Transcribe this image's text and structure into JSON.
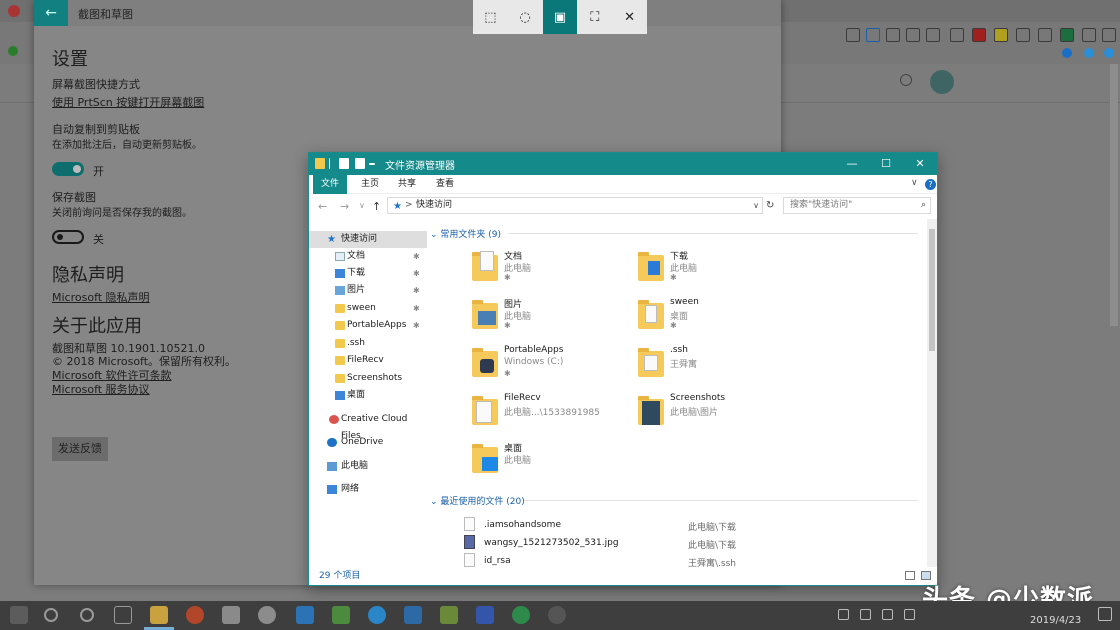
{
  "background": {
    "watermark": "头条 @少数派",
    "date": "2019/4/23"
  },
  "snip_window": {
    "title": "截图和草图",
    "back_glyph": "←",
    "settings_heading": "设置",
    "shortcut_label": "屏幕截图快捷方式",
    "shortcut_link": "使用 PrtScn 按键打开屏幕截图",
    "auto_copy_label": "自动复制到剪贴板",
    "auto_copy_desc": "在添加批注后，自动更新剪贴板。",
    "toggle_on_label": "开",
    "save_label": "保存截图",
    "save_desc": "关闭前询问是否保存我的截图。",
    "toggle_off_label": "关",
    "privacy_heading": "隐私声明",
    "privacy_link": "Microsoft 隐私声明",
    "about_heading": "关于此应用",
    "version": "截图和草图 10.1901.10521.0",
    "copyright": "© 2018 Microsoft。保留所有权利。",
    "license_link": "Microsoft 软件许可条款",
    "services_link": "Microsoft 服务协议",
    "feedback_button": "发送反馈"
  },
  "capture_toolbar": {
    "buttons": [
      {
        "icon": "rect-snip-icon",
        "glyph": "⬚"
      },
      {
        "icon": "freeform-snip-icon",
        "glyph": "◌"
      },
      {
        "icon": "window-snip-icon",
        "glyph": "▣"
      },
      {
        "icon": "fullscreen-snip-icon",
        "glyph": "⛶"
      },
      {
        "icon": "close-icon",
        "glyph": "✕"
      }
    ],
    "active_index": 2
  },
  "explorer": {
    "title": "文件资源管理器",
    "window_buttons": {
      "minimize": "—",
      "maximize": "☐",
      "close": "✕"
    },
    "ribbon_tabs": [
      "文件",
      "主页",
      "共享",
      "查看"
    ],
    "help": "?",
    "nav_back": "←",
    "nav_forward": "→",
    "nav_recent": "∨",
    "nav_up": "↑",
    "address_sep": ">",
    "address": "快速访问",
    "search_placeholder": "搜索\"快速访问\"",
    "search_glyph": "⌕",
    "refresh_glyph": "↻",
    "dropdown_glyph": "∨",
    "expand_glyph": "∨",
    "pin_glyph": "✱",
    "nav": [
      {
        "label": "快速访问",
        "pinned": false
      },
      {
        "label": "文档",
        "pinned": true
      },
      {
        "label": "下载",
        "pinned": true
      },
      {
        "label": "图片",
        "pinned": true
      },
      {
        "label": "sween",
        "pinned": true
      },
      {
        "label": "PortableApps",
        "pinned": true
      },
      {
        "label": ".ssh",
        "pinned": false
      },
      {
        "label": "FileRecv",
        "pinned": false
      },
      {
        "label": "Screenshots",
        "pinned": false
      },
      {
        "label": "桌面",
        "pinned": false
      },
      {
        "label": "Creative Cloud Files",
        "pinned": false
      },
      {
        "label": "OneDrive",
        "pinned": false
      },
      {
        "label": "此电脑",
        "pinned": false
      },
      {
        "label": "网络",
        "pinned": false
      }
    ],
    "frequent_header": "常用文件夹 (9)",
    "frequent": [
      {
        "name": "文档",
        "location": "此电脑",
        "pinned": true
      },
      {
        "name": "下载",
        "location": "此电脑",
        "pinned": true
      },
      {
        "name": "图片",
        "location": "此电脑",
        "pinned": true
      },
      {
        "name": "sween",
        "location": "桌面",
        "pinned": true
      },
      {
        "name": "PortableApps",
        "location": "Windows (C:)",
        "pinned": true
      },
      {
        "name": ".ssh",
        "location": "王舜寓",
        "pinned": false
      },
      {
        "name": "FileRecv",
        "location": "此电脑...\\1533891985",
        "pinned": false
      },
      {
        "name": "Screenshots",
        "location": "此电脑\\图片",
        "pinned": false
      },
      {
        "name": "桌面",
        "location": "此电脑",
        "pinned": false
      }
    ],
    "recent_header": "最近使用的文件 (20)",
    "recent": [
      {
        "name": ".iamsohandsome",
        "location": "此电脑\\下载"
      },
      {
        "name": "wangsy_1521273502_531.jpg",
        "location": "此电脑\\下载"
      },
      {
        "name": "id_rsa",
        "location": "王舜寓\\.ssh"
      }
    ],
    "status": "29 个项目"
  },
  "colors": {
    "accent": "#158a8a",
    "link": "#1a5fa8",
    "folder": "#f5ca5b"
  }
}
